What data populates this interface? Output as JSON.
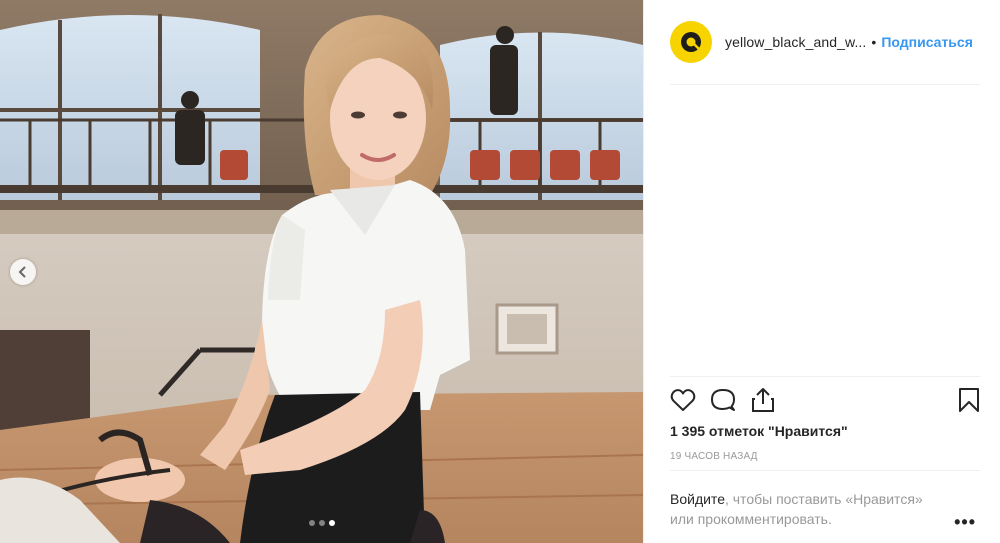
{
  "header": {
    "username": "yellow_black_and_w...",
    "separator": "•",
    "follow_label": "Подписаться"
  },
  "post": {
    "likes_text": "1 395 отметок \"Нравится\"",
    "time_text": "19 ЧАСОВ НАЗАД"
  },
  "login_prompt": {
    "login_link": "Войдите",
    "rest": ", чтобы поставить «Нравится» или прокомментировать."
  },
  "more_label": "•••",
  "carousel": {
    "count": 3,
    "active_index": 2
  },
  "icons": {
    "like": "heart-icon",
    "comment": "comment-icon",
    "share": "share-icon",
    "save": "bookmark-icon",
    "prev": "chevron-left-icon"
  },
  "colors": {
    "avatar_bg": "#f7d300",
    "follow": "#3897f0",
    "text": "#262626",
    "muted": "#999999"
  }
}
